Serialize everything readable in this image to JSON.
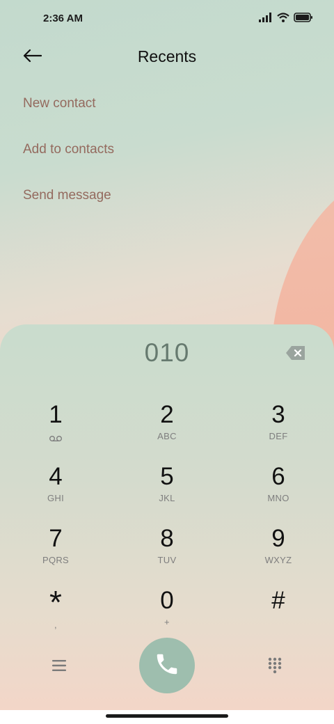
{
  "status_bar": {
    "time": "2:36 AM",
    "icons": [
      "signal-icon",
      "wifi-icon",
      "battery-icon"
    ]
  },
  "header": {
    "title": "Recents",
    "back_icon": "back-arrow-icon"
  },
  "menu": {
    "items": [
      {
        "label": "New contact"
      },
      {
        "label": "Add to contacts"
      },
      {
        "label": "Send message"
      }
    ]
  },
  "dialer": {
    "number": "010",
    "keys": [
      {
        "digit": "1",
        "letters": "",
        "sub_icon": "voicemail-icon"
      },
      {
        "digit": "2",
        "letters": "ABC"
      },
      {
        "digit": "3",
        "letters": "DEF"
      },
      {
        "digit": "4",
        "letters": "GHI"
      },
      {
        "digit": "5",
        "letters": "JKL"
      },
      {
        "digit": "6",
        "letters": "MNO"
      },
      {
        "digit": "7",
        "letters": "PQRS"
      },
      {
        "digit": "8",
        "letters": "TUV"
      },
      {
        "digit": "9",
        "letters": "WXYZ"
      },
      {
        "digit": "*",
        "letters": ","
      },
      {
        "digit": "0",
        "letters": "+"
      },
      {
        "digit": "#",
        "letters": ""
      }
    ],
    "bottom_icons": [
      "menu-lines-icon",
      "phone-icon",
      "keypad-grid-icon",
      "backspace-icon"
    ]
  },
  "colors": {
    "menu_text": "#946a5e",
    "call_button": "#9ebeae",
    "number_text": "#667a6f"
  }
}
